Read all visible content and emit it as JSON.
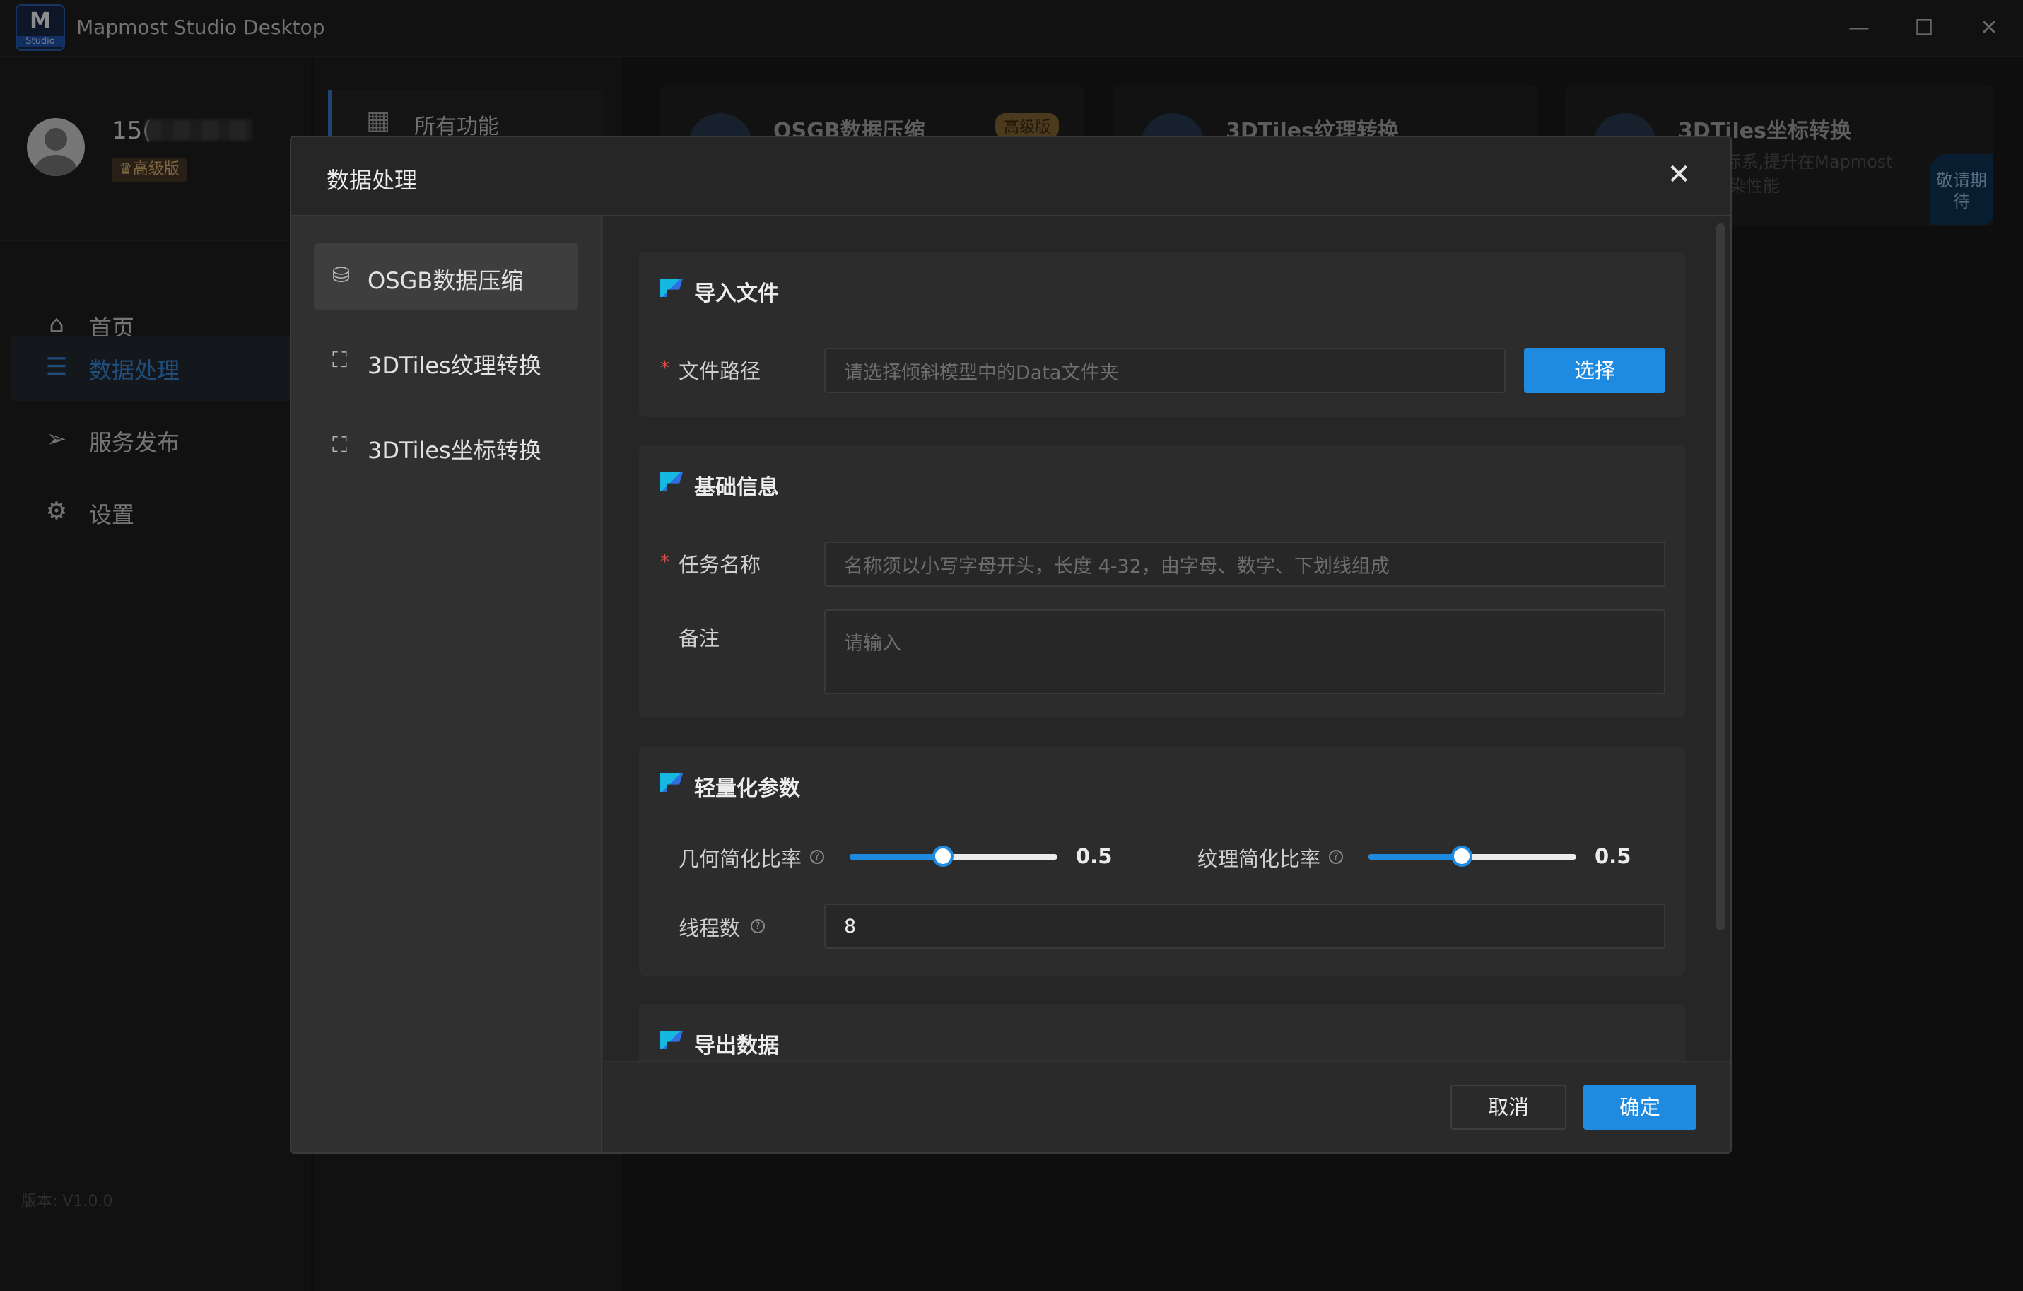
{
  "window": {
    "title": "Mapmost Studio Desktop",
    "logo_letter": "M",
    "logo_sub": "Studio",
    "controls": {
      "minimize": "—",
      "maximize": "☐",
      "close": "✕"
    }
  },
  "user": {
    "name_prefix": "15(",
    "badge": "♛高级版"
  },
  "sidebar": {
    "items": [
      {
        "label": "首页",
        "icon": "home-icon",
        "glyph": "⌂"
      },
      {
        "label": "数据处理",
        "icon": "database-icon",
        "glyph": "☰"
      },
      {
        "label": "服务发布",
        "icon": "send-icon",
        "glyph": "➢"
      },
      {
        "label": "设置",
        "icon": "gear-icon",
        "glyph": "⚙"
      }
    ],
    "version": "版本: V1.0.0"
  },
  "secondary": {
    "all_functions": "所有功能",
    "grid_glyph": "▦"
  },
  "background_cards": [
    {
      "title": "OSGB数据压缩",
      "badge": "高级版"
    },
    {
      "title": "3DTiles纹理转换"
    },
    {
      "title": "3DTiles坐标转换",
      "desc_line1": "MM坐标系,提升在Mapmost",
      "desc_line2": "的加渲染性能",
      "tag": "敬请期待"
    }
  ],
  "modal": {
    "title": "数据处理",
    "close_glyph": "✕",
    "nav": [
      {
        "label": "OSGB数据压缩",
        "glyph": "⛁"
      },
      {
        "label": "3DTiles纹理转换",
        "glyph": "⛶"
      },
      {
        "label": "3DTiles坐标转换",
        "glyph": "⛶"
      }
    ],
    "sections": {
      "import": {
        "title": "导入文件",
        "path_label": "文件路径",
        "path_placeholder": "请选择倾斜模型中的Data文件夹",
        "choose_button": "选择"
      },
      "basic": {
        "title": "基础信息",
        "task_label": "任务名称",
        "task_placeholder": "名称须以小写字母开头，长度 4-32，由字母、数字、下划线组成",
        "note_label": "备注",
        "note_placeholder": "请输入"
      },
      "lightweight": {
        "title": "轻量化参数",
        "geometry_label": "几何简化比率",
        "geometry_value": "0.5",
        "geometry_fraction": 0.45,
        "texture_label": "纹理简化比率",
        "texture_value": "0.5",
        "texture_fraction": 0.45,
        "threads_label": "线程数",
        "threads_value": "8",
        "help_glyph": "?"
      },
      "export": {
        "title": "导出数据"
      }
    },
    "footer": {
      "cancel": "取消",
      "confirm": "确定"
    }
  }
}
